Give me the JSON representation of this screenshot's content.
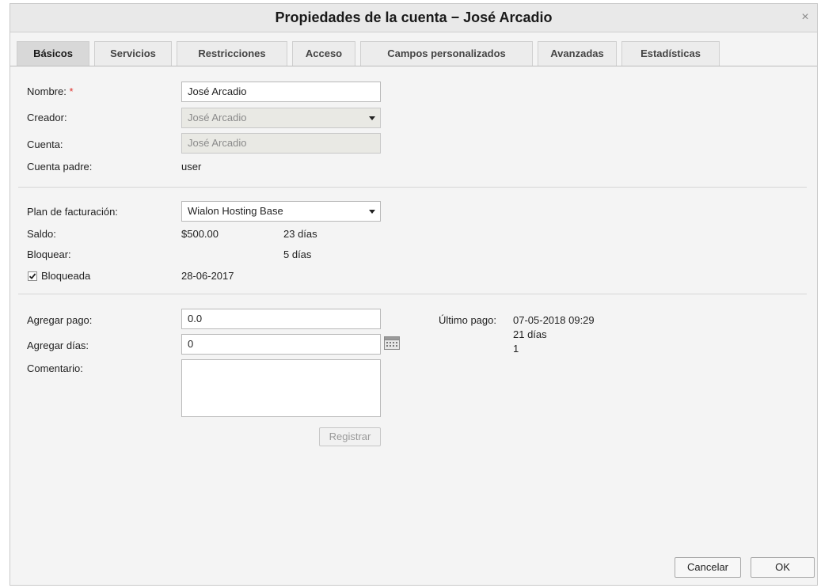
{
  "dialog": {
    "title": "Propiedades de la cuenta − José Arcadio",
    "close_symbol": "×"
  },
  "tabs": [
    {
      "label": "Básicos",
      "active": true
    },
    {
      "label": "Servicios"
    },
    {
      "label": "Restricciones"
    },
    {
      "label": "Acceso"
    },
    {
      "label": "Campos personalizados"
    },
    {
      "label": "Avanzadas"
    },
    {
      "label": "Estadísticas"
    }
  ],
  "basic": {
    "name_label": "Nombre:",
    "required_mark": "*",
    "name_value": "José Arcadio",
    "creator_label": "Creador:",
    "creator_value": "José Arcadio",
    "account_label": "Cuenta:",
    "account_value": "José Arcadio",
    "parent_label": "Cuenta padre:",
    "parent_value": "user"
  },
  "billing": {
    "plan_label": "Plan de facturación:",
    "plan_value": "Wialon Hosting Base",
    "balance_label": "Saldo:",
    "balance_value": "$500.00",
    "balance_days": "23 días",
    "block_label": "Bloquear:",
    "block_days": "5 días",
    "blocked_label": "Bloqueada",
    "blocked_checked": true,
    "blocked_date": "28-06-2017"
  },
  "payment": {
    "add_payment_label": "Agregar pago:",
    "add_payment_value": "0.0",
    "add_days_label": "Agregar días:",
    "add_days_value": "0",
    "comment_label": "Comentario:",
    "register_label": "Registrar",
    "last_payment_label": "Último pago:",
    "last_payment_date": "07-05-2018 09:29",
    "last_payment_days": "21 días",
    "last_payment_count": "1"
  },
  "footer": {
    "cancel_label": "Cancelar",
    "ok_label": "OK"
  },
  "icons": {
    "dropdown": "chevron-down-icon",
    "calendar": "calendar-icon",
    "checkbox": "check-icon",
    "close": "close-icon"
  }
}
